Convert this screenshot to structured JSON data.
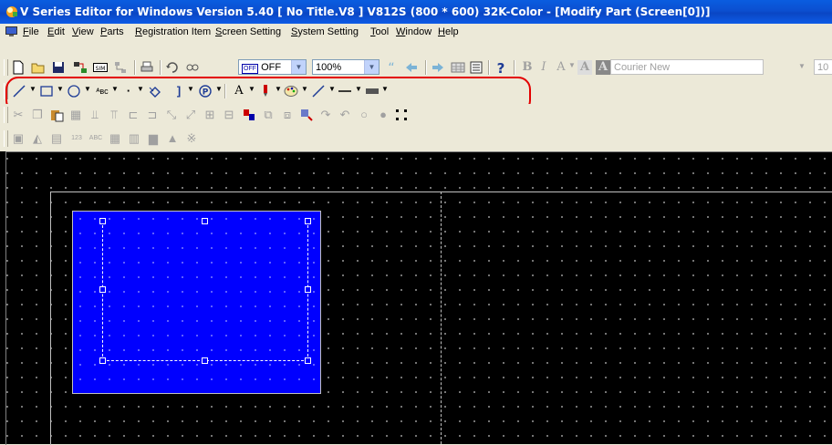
{
  "window": {
    "title": "V Series Editor for Windows Version 5.40 [ No Title.V8 ] V812S (800 * 600) 32K-Color - [Modify Part (Screen[0])]"
  },
  "menu": {
    "items": [
      "File",
      "Edit",
      "View",
      "Parts",
      "Registration Item",
      "Screen Setting",
      "System Setting",
      "Tool",
      "Window",
      "Help"
    ]
  },
  "toolbar1": {
    "off_label": "OFF",
    "zoom_value": "100%",
    "font_value": "Courier New",
    "fontsize_value": "10"
  },
  "toolbar2": {
    "text_tool": "ᴬʙᴄ",
    "font_color_glyph": "A"
  },
  "colors": {
    "accent_titlebar": "#0a5de0",
    "part_fill": "#0000ff",
    "workspace": "#000000",
    "highlight": "#e30000"
  }
}
